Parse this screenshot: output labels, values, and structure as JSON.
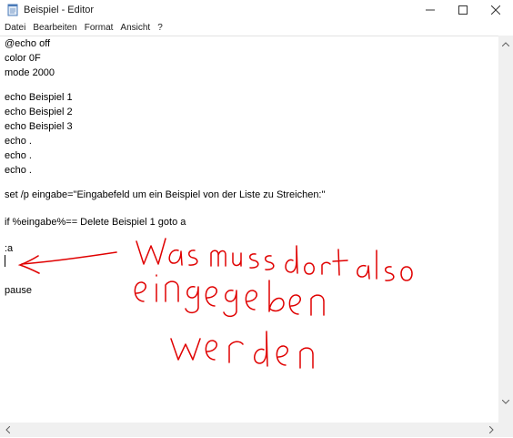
{
  "window": {
    "title": "Beispiel - Editor",
    "minimize_icon": "minimize-icon",
    "maximize_icon": "maximize-icon",
    "close_icon": "close-icon",
    "app_icon": "notepad-icon"
  },
  "menu": {
    "items": [
      "Datei",
      "Bearbeiten",
      "Format",
      "Ansicht",
      "?"
    ]
  },
  "editor": {
    "lines": [
      "@echo off",
      "color 0F",
      "mode 2000",
      "",
      "echo Beispiel 1",
      "echo Beispiel 2",
      "echo Beispiel 3",
      "echo .",
      "echo .",
      "echo .",
      "",
      "set /p eingabe=\"Eingabefeld um ein Beispiel von der Liste zu Streichen:\"",
      "",
      "if %eingabe%== Delete Beispiel 1 goto a",
      "",
      ":a",
      "",
      "pause"
    ]
  },
  "annotation": {
    "text_line_1": "Was muss dort also",
    "text_line_2": "eingegeben",
    "text_line_3": "werden",
    "color": "#e00000"
  },
  "colors": {
    "background": "#ffffff",
    "scrollbar": "#f0f0f0",
    "annotation_red": "#e00000"
  }
}
